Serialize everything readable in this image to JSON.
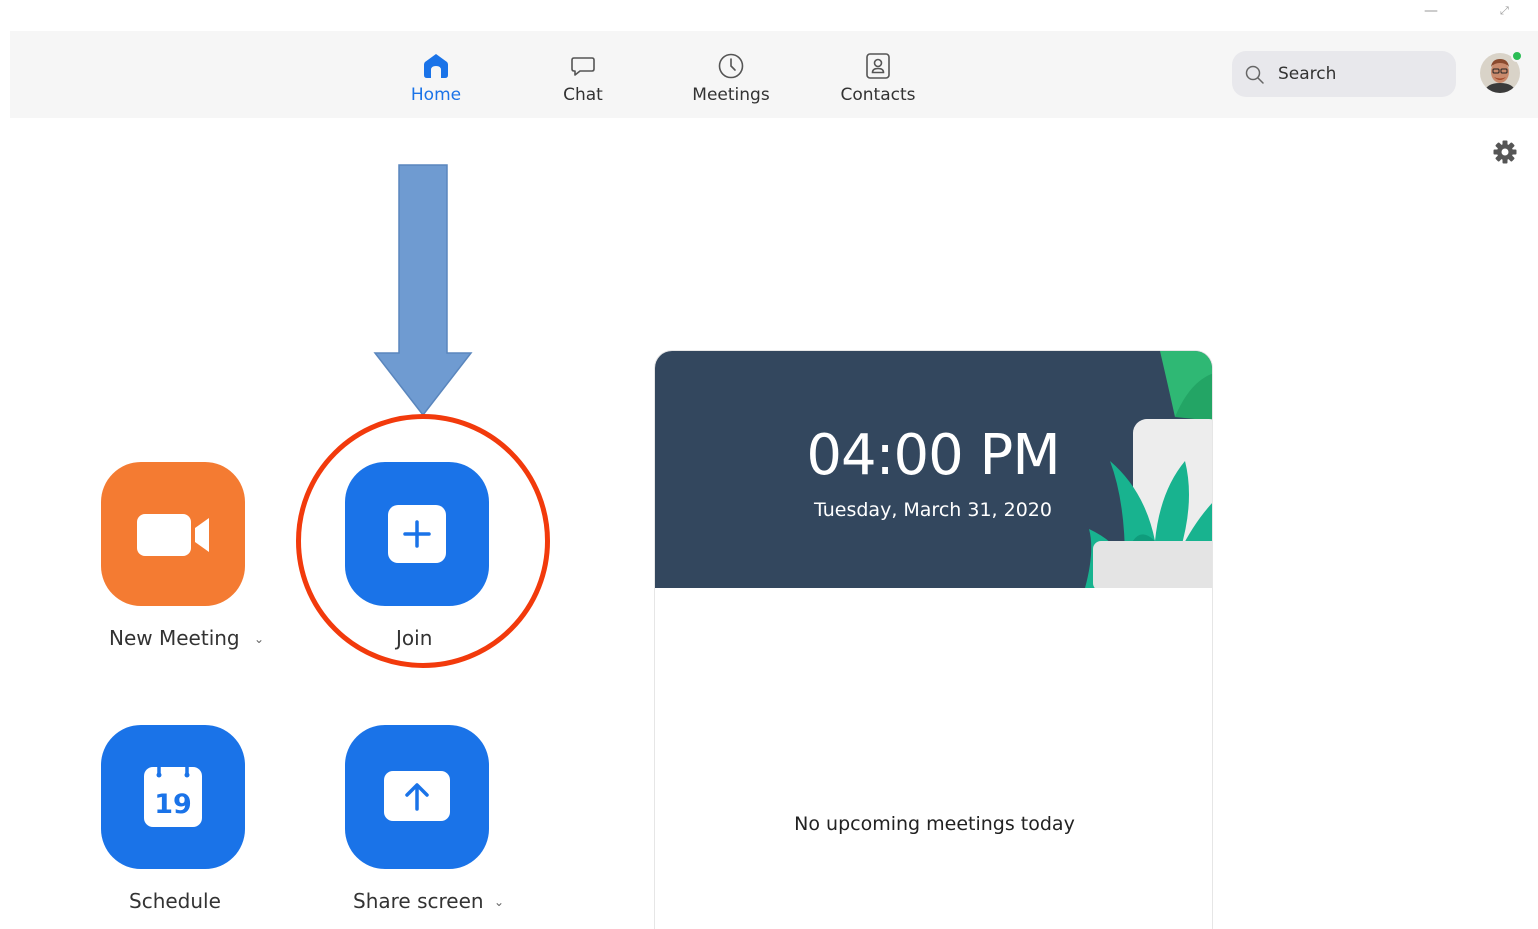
{
  "window": {
    "minimize_glyph": "—",
    "maximize_glyph": "⤢"
  },
  "nav": {
    "items": [
      {
        "label": "Home",
        "icon": "home-icon",
        "active": true
      },
      {
        "label": "Chat",
        "icon": "chat-bubble-icon",
        "active": false
      },
      {
        "label": "Meetings",
        "icon": "clock-icon",
        "active": false
      },
      {
        "label": "Contacts",
        "icon": "contact-card-icon",
        "active": false
      }
    ]
  },
  "search": {
    "placeholder": "Search"
  },
  "actions": {
    "new_meeting": {
      "label": "New Meeting",
      "chevron": "⌄"
    },
    "join": {
      "label": "Join"
    },
    "schedule": {
      "label": "Schedule",
      "calendar_day": "19"
    },
    "share_screen": {
      "label": "Share screen",
      "chevron": "⌄"
    }
  },
  "calendar": {
    "time": "04:00 PM",
    "date": "Tuesday, March 31, 2020",
    "empty_message": "No upcoming meetings today"
  },
  "colors": {
    "accent_blue": "#1a73e8",
    "orange": "#f47b32",
    "annotation_red": "#f23a0c",
    "annotation_arrow": "#6f9bd1",
    "header_navy": "#33475e",
    "online_green": "#2bbd55"
  }
}
